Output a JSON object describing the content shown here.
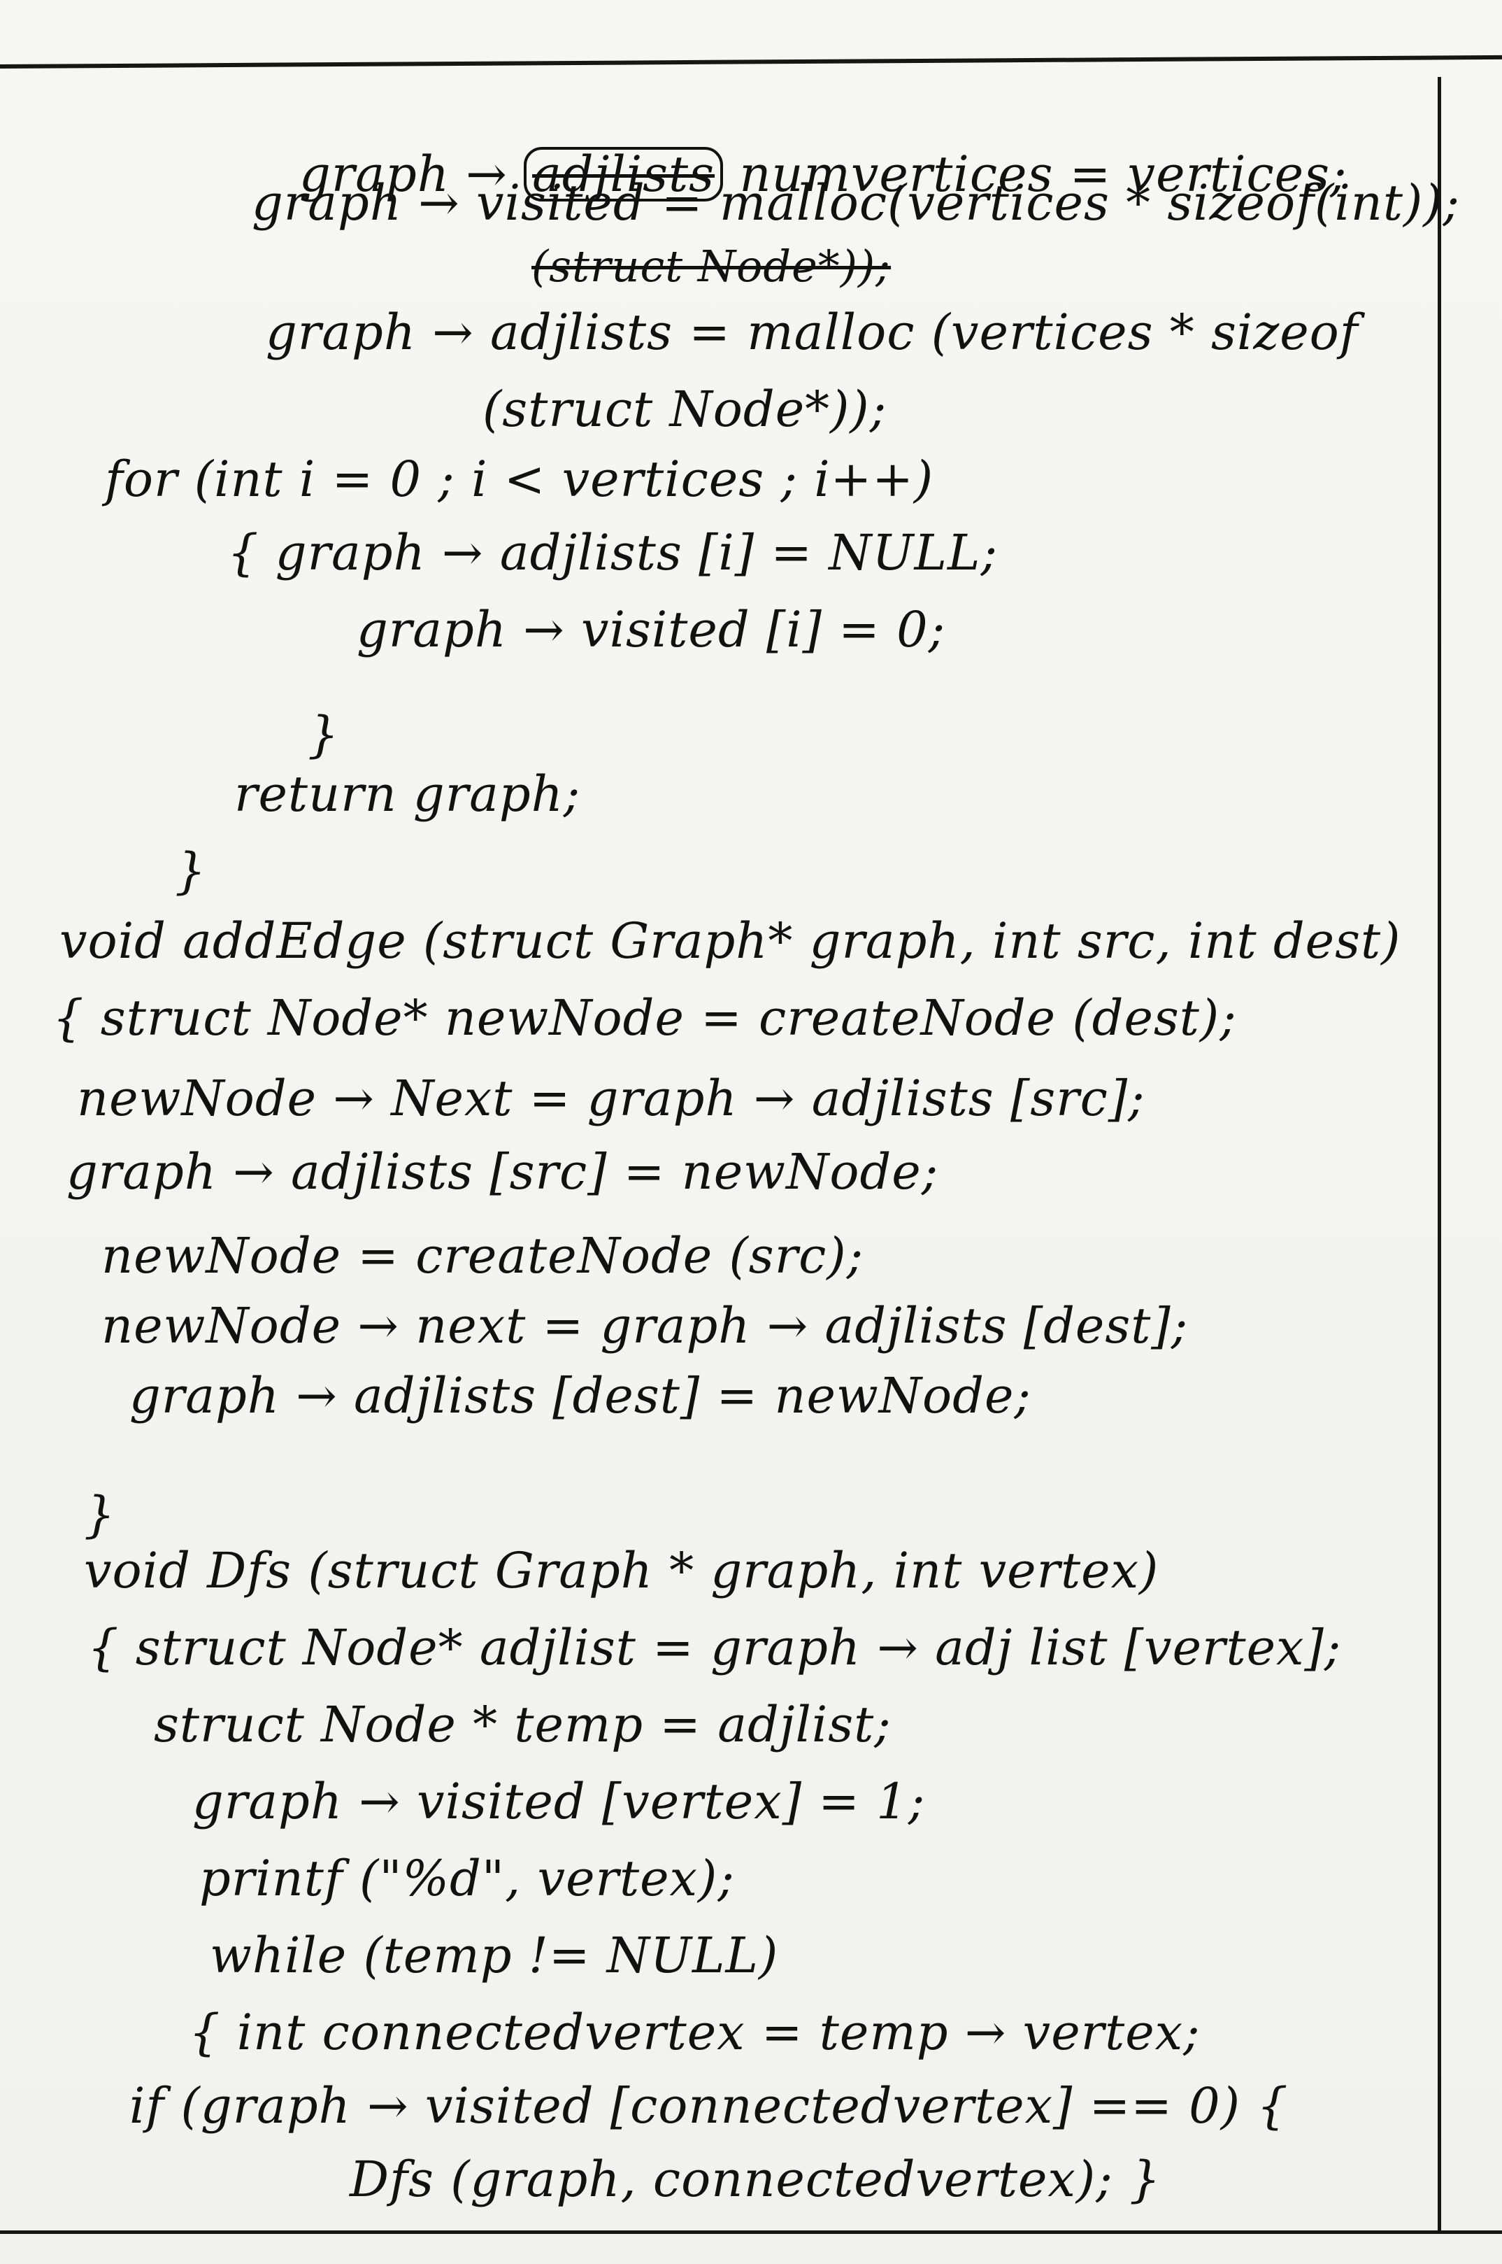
{
  "lines": [
    {
      "text": "graph → "
    },
    {
      "text": "adjlists"
    },
    {
      "text": " numvertices = vertices;"
    },
    {
      "text": "graph → visited = malloc(vertices * sizeof(int));"
    },
    {
      "text": "(struct Node*));"
    },
    {
      "text": "graph → adjlists = malloc (vertices * sizeof"
    },
    {
      "text": "(struct Node*));"
    },
    {
      "text": "for (int i = 0 ; i < vertices ; i++)"
    },
    {
      "text": "{ graph → adjlists [i] = NULL;"
    },
    {
      "text": "graph → visited [i] = 0;"
    },
    {
      "text": "}"
    },
    {
      "text": "return graph;"
    },
    {
      "text": "}"
    },
    {
      "text": "void addEdge (struct Graph* graph, int src, int dest)"
    },
    {
      "text": "{ struct Node* newNode = createNode (dest);"
    },
    {
      "text": "newNode → Next = graph → adjlists [src];"
    },
    {
      "text": "graph → adjlists [src] = newNode;"
    },
    {
      "text": "newNode = createNode (src);"
    },
    {
      "text": "newNode → next = graph → adjlists [dest];"
    },
    {
      "text": "graph → adjlists [dest] = newNode;"
    },
    {
      "text": "}"
    },
    {
      "text": "void Dfs (struct Graph * graph, int vertex)"
    },
    {
      "text": "{ struct Node* adjlist = graph → adj list [vertex];"
    },
    {
      "text": "struct Node * temp = adjlist;"
    },
    {
      "text": "graph → visited [vertex] = 1;"
    },
    {
      "text": "printf (\"%d\", vertex);"
    },
    {
      "text": "while (temp != NULL)"
    },
    {
      "text": "{ int connectedvertex = temp → vertex;"
    },
    {
      "text": "if (graph → visited [connectedvertex] == 0) {"
    },
    {
      "text": "Dfs (graph, connectedvertex); }"
    }
  ]
}
